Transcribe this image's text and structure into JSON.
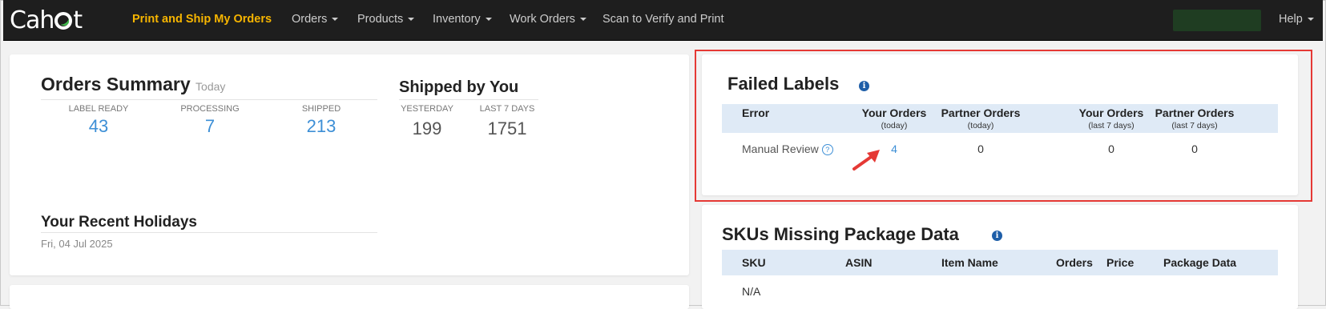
{
  "brand": {
    "name_left": "Cah",
    "name_right": "t"
  },
  "nav": {
    "items": [
      {
        "label": "Print and Ship My Orders",
        "active": true,
        "dropdown": false
      },
      {
        "label": "Orders",
        "dropdown": true
      },
      {
        "label": "Products",
        "dropdown": true
      },
      {
        "label": "Inventory",
        "dropdown": true
      },
      {
        "label": "Work Orders",
        "dropdown": true
      },
      {
        "label": "Scan to Verify and Print",
        "dropdown": false
      }
    ],
    "help": "Help"
  },
  "orders_summary": {
    "title": "Orders Summary",
    "subtitle": "Today",
    "stats": [
      {
        "label": "LABEL READY",
        "value": "43"
      },
      {
        "label": "PROCESSING",
        "value": "7"
      },
      {
        "label": "SHIPPED",
        "value": "213"
      }
    ]
  },
  "shipped_by_you": {
    "title": "Shipped by You",
    "stats": [
      {
        "label": "YESTERDAY",
        "value": "199"
      },
      {
        "label": "LAST 7 DAYS",
        "value": "1751"
      }
    ]
  },
  "holidays": {
    "title": "Your Recent Holidays",
    "date": "Fri, 04 Jul 2025"
  },
  "failed_labels": {
    "title": "Failed Labels",
    "info_icon": "info-icon",
    "columns": [
      {
        "label": "Error",
        "sub": ""
      },
      {
        "label": "Your Orders",
        "sub": "(today)"
      },
      {
        "label": "Partner Orders",
        "sub": "(today)"
      },
      {
        "label": "Your Orders",
        "sub": "(last 7 days)"
      },
      {
        "label": "Partner Orders",
        "sub": "(last 7 days)"
      }
    ],
    "rows": [
      {
        "error": "Manual Review",
        "values": [
          "4",
          "0",
          "0",
          "0"
        ]
      }
    ]
  },
  "skus_missing": {
    "title": "SKUs Missing Package Data",
    "columns": [
      "SKU",
      "ASIN",
      "Item Name",
      "Orders",
      "Price",
      "Package Data"
    ],
    "rows": [
      [
        "N/A"
      ]
    ]
  },
  "colors": {
    "accent": "#f7b500",
    "link": "#3d8fd6",
    "highlight": "#e53935",
    "arrow": "#e53935"
  }
}
